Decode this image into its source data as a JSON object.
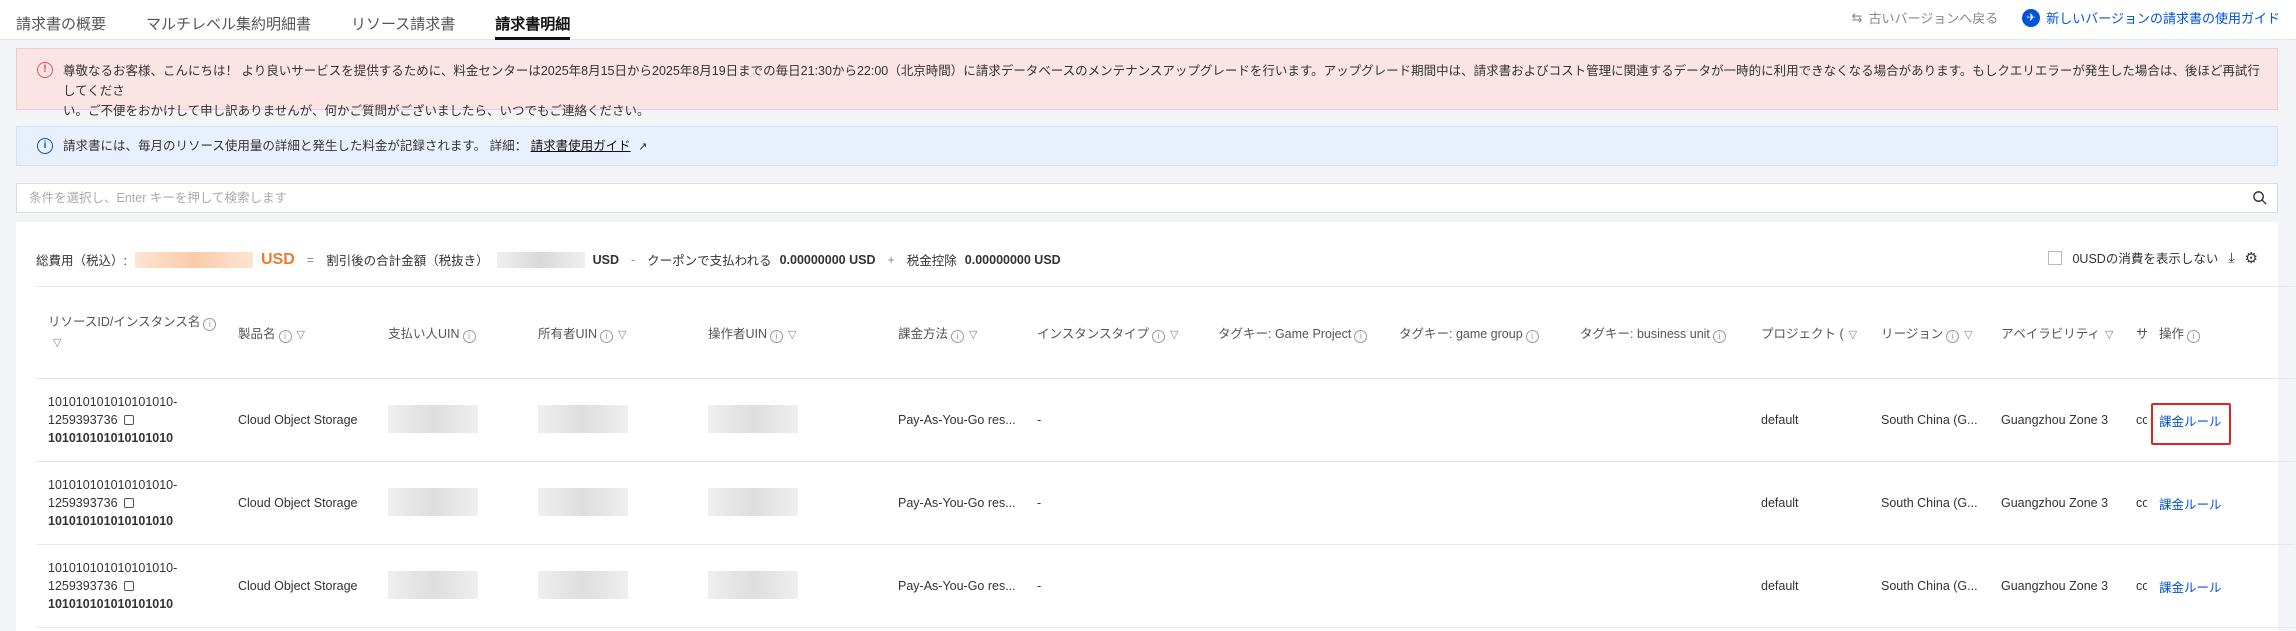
{
  "tabs": [
    "請求書の概要",
    "マルチレベル集約明細書",
    "リソース請求書",
    "請求書明細"
  ],
  "top_links": {
    "old": "古いバージョンへ戻る",
    "new": "新しいバージョンの請求書の使用ガイド"
  },
  "alert_red": {
    "line1": "尊敬なるお客様、こんにちは！ より良いサービスを提供するために、料金センターは2025年8月15日から2025年8月19日までの毎日21:30から22:00（北京時間）に請求データベースのメンテナンスアップグレードを行います。アップグレード期間中は、請求書およびコスト管理に関連するデータが一時的に利用できなくなる場合があります。もしクエリエラーが発生した場合は、後ほど再試行してくださ",
    "line2": "い。ご不便をおかけして申し訳ありませんが、何かご質問がございましたら、いつでもご連絡ください。"
  },
  "alert_blue": {
    "text": "請求書には、毎月のリソース使用量の詳細と発生した料金が記録されます。 詳細：",
    "link": "請求書使用ガイド"
  },
  "search": {
    "placeholder": "条件を選択し、Enter キーを押して検索します"
  },
  "summary": {
    "total_label": "総費用（税込）:",
    "usd": "USD",
    "eq": "=",
    "subtotal_label": "割引後の合計金額（税抜き）",
    "minus": "-",
    "coupon_label": "クーポンで支払われる",
    "coupon_value": "0.00000000 USD",
    "plus": "+",
    "tax_label": "税金控除",
    "tax_value": "0.00000000 USD",
    "hide_zero": "0USDの消費を表示しない"
  },
  "columns": [
    "リソースID/インスタンス名",
    "製品名",
    "支払い人UIN",
    "所有者UIN",
    "操作者UIN",
    "課金方法",
    "インスタンスタイプ",
    "タグキー: Game Project",
    "タグキー: game group",
    "タグキー: business unit",
    "プロジェクト (",
    "リージョン",
    "アベイラビリティ",
    "サブ",
    "操作"
  ],
  "rows": [
    {
      "id1": "101010101010101010-",
      "id2": "1259393736",
      "name": "101010101010101010",
      "product": "Cloud Object Storage",
      "billing": "Pay-As-You-Go res...",
      "instance_type": "-",
      "project": "default",
      "region": "South China (G...",
      "zone": "Guangzhou Zone 3",
      "sub": "cos i",
      "action": "課金ルール"
    },
    {
      "id1": "101010101010101010-",
      "id2": "1259393736",
      "name": "101010101010101010",
      "product": "Cloud Object Storage",
      "billing": "Pay-As-You-Go res...",
      "instance_type": "-",
      "project": "default",
      "region": "South China (G...",
      "zone": "Guangzhou Zone 3",
      "sub": "cos i",
      "action": "課金ルール"
    },
    {
      "id1": "101010101010101010-",
      "id2": "1259393736",
      "name": "101010101010101010",
      "product": "Cloud Object Storage",
      "billing": "Pay-As-You-Go res...",
      "instance_type": "-",
      "project": "default",
      "region": "South China (G...",
      "zone": "Guangzhou Zone 3",
      "sub": "cos i",
      "action": "課金ルール"
    }
  ]
}
